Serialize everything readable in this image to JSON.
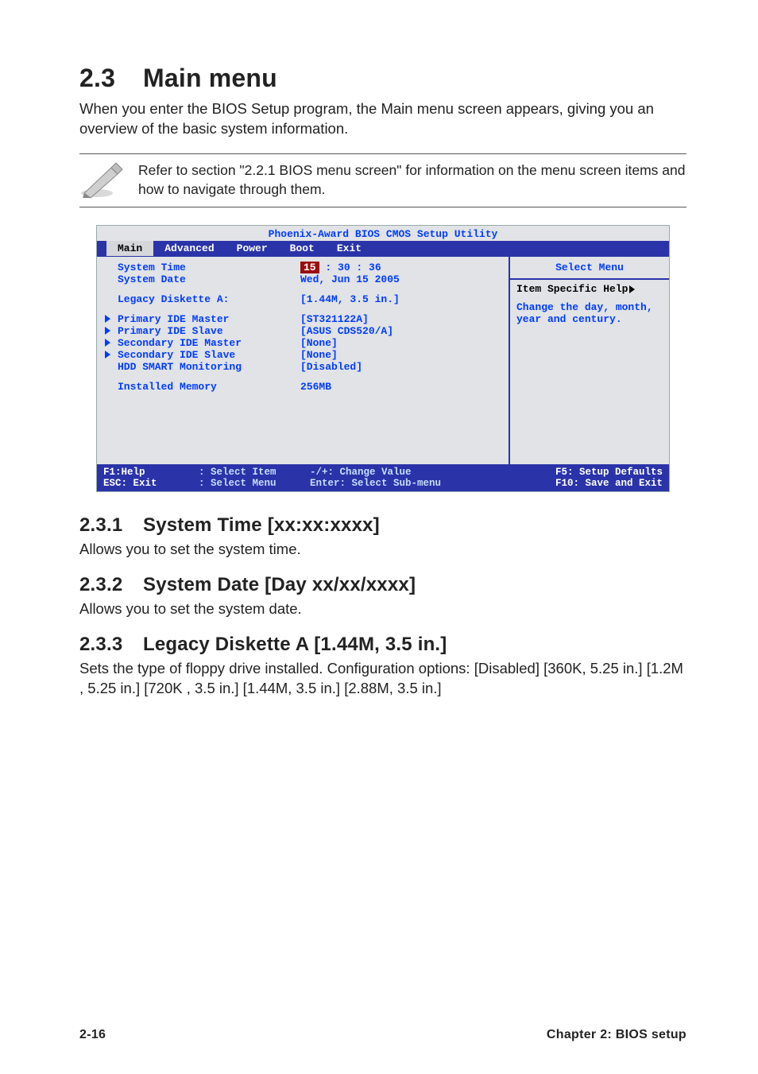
{
  "section": {
    "number": "2.3",
    "title": "Main menu",
    "intro": "When you enter the BIOS Setup program, the Main menu screen appears, giving you an overview of the basic system information.",
    "note": "Refer to section \"2.2.1  BIOS menu screen\" for information on the menu screen items and how to navigate through them."
  },
  "bios": {
    "utility_title": "Phoenix-Award BIOS CMOS Setup Utility",
    "tabs": [
      "Main",
      "Advanced",
      "Power",
      "Boot",
      "Exit"
    ],
    "active_tab": "Main",
    "fields": {
      "system_time_label": "System Time",
      "system_time_hl": "15",
      "system_time_rest": " : 30 : 36",
      "system_date_label": "System Date",
      "system_date_value": "Wed, Jun 15 2005",
      "legacy_diskette_label": "Legacy Diskette A:",
      "legacy_diskette_value": "[1.44M, 3.5 in.]",
      "primary_ide_master_label": "Primary IDE Master",
      "primary_ide_master_value": "[ST321122A]",
      "primary_ide_slave_label": "Primary IDE Slave",
      "primary_ide_slave_value": "[ASUS CDS520/A]",
      "secondary_ide_master_label": "Secondary IDE Master",
      "secondary_ide_master_value": "[None]",
      "secondary_ide_slave_label": "Secondary IDE Slave",
      "secondary_ide_slave_value": "[None]",
      "hdd_smart_label": "HDD SMART Monitoring",
      "hdd_smart_value": "[Disabled]",
      "installed_memory_label": "Installed Memory",
      "installed_memory_value": "256MB"
    },
    "right": {
      "title": "Select Menu",
      "help_label": "Item Specific Help",
      "help_text": "Change the day, month, year and century."
    },
    "legend": {
      "l1a": "F1:Help",
      "l1b": ": Select Item",
      "l1c": "-/+: Change Value",
      "l1d": "F5: Setup Defaults",
      "l2a": "ESC: Exit",
      "l2b": ": Select Menu",
      "l2c": "Enter: Select Sub-menu",
      "l2d": "F10: Save and Exit"
    }
  },
  "subsections": {
    "s1_num": "2.3.1",
    "s1_title": "System Time [xx:xx:xxxx]",
    "s1_body": "Allows you to set the system time.",
    "s2_num": "2.3.2",
    "s2_title": "System Date [Day xx/xx/xxxx]",
    "s2_body": "Allows you to set the system date.",
    "s3_num": "2.3.3",
    "s3_title": "Legacy Diskette A [1.44M, 3.5 in.]",
    "s3_body": "Sets the type of floppy drive installed. Configuration options: [Disabled] [360K, 5.25 in.] [1.2M , 5.25 in.] [720K , 3.5 in.] [1.44M, 3.5 in.] [2.88M, 3.5 in.]"
  },
  "footer": {
    "left": "2-16",
    "right": "Chapter 2: BIOS setup"
  }
}
